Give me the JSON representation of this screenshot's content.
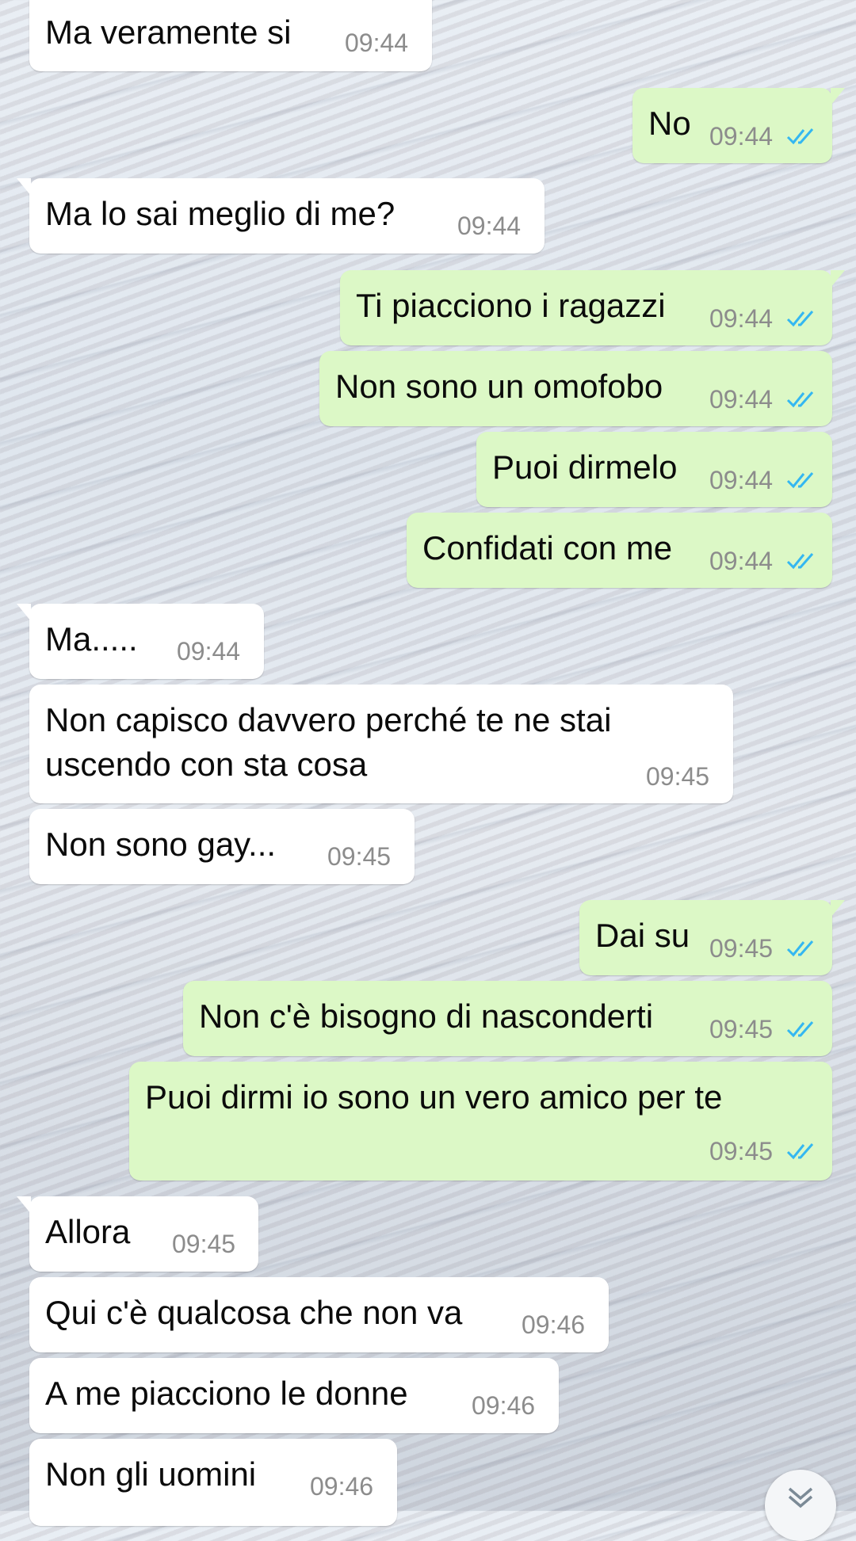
{
  "chat": {
    "messages": [
      {
        "dir": "in",
        "text": "Ma veramente si",
        "time": "09:44"
      },
      {
        "dir": "out",
        "text": "No",
        "time": "09:44",
        "status": "read"
      },
      {
        "dir": "in",
        "text": "Ma lo sai meglio di me?",
        "time": "09:44"
      },
      {
        "dir": "out",
        "text": "Ti piacciono i ragazzi",
        "time": "09:44",
        "status": "read"
      },
      {
        "dir": "out",
        "text": "Non sono un omofobo",
        "time": "09:44",
        "status": "read"
      },
      {
        "dir": "out",
        "text": "Puoi dirmelo",
        "time": "09:44",
        "status": "read"
      },
      {
        "dir": "out",
        "text": "Confidati con me",
        "time": "09:44",
        "status": "read"
      },
      {
        "dir": "in",
        "text": "Ma.....",
        "time": "09:44"
      },
      {
        "dir": "in",
        "text": "Non capisco davvero perché te ne stai uscendo con sta cosa",
        "time": "09:45"
      },
      {
        "dir": "in",
        "text": "Non sono gay...",
        "time": "09:45"
      },
      {
        "dir": "out",
        "text": "Dai su",
        "time": "09:45",
        "status": "read"
      },
      {
        "dir": "out",
        "text": "Non c'è bisogno di nasconderti",
        "time": "09:45",
        "status": "read"
      },
      {
        "dir": "out",
        "text": "Puoi dirmi io sono un vero amico per te",
        "time": "09:45",
        "status": "read"
      },
      {
        "dir": "in",
        "text": "Allora",
        "time": "09:45"
      },
      {
        "dir": "in",
        "text": "Qui c'è qualcosa che non va",
        "time": "09:46"
      },
      {
        "dir": "in",
        "text": "A me piacciono le donne",
        "time": "09:46"
      },
      {
        "dir": "in",
        "text": "Non gli uomini",
        "time": "09:46"
      }
    ]
  },
  "colors": {
    "incoming_bubble": "#ffffff",
    "outgoing_bubble": "#dcf8c6",
    "timestamp": "#8c8c8c",
    "read_ticks": "#34b7f1"
  },
  "icons": {
    "read_status": "double-check-icon",
    "scroll_down": "chevron-double-down-icon"
  }
}
